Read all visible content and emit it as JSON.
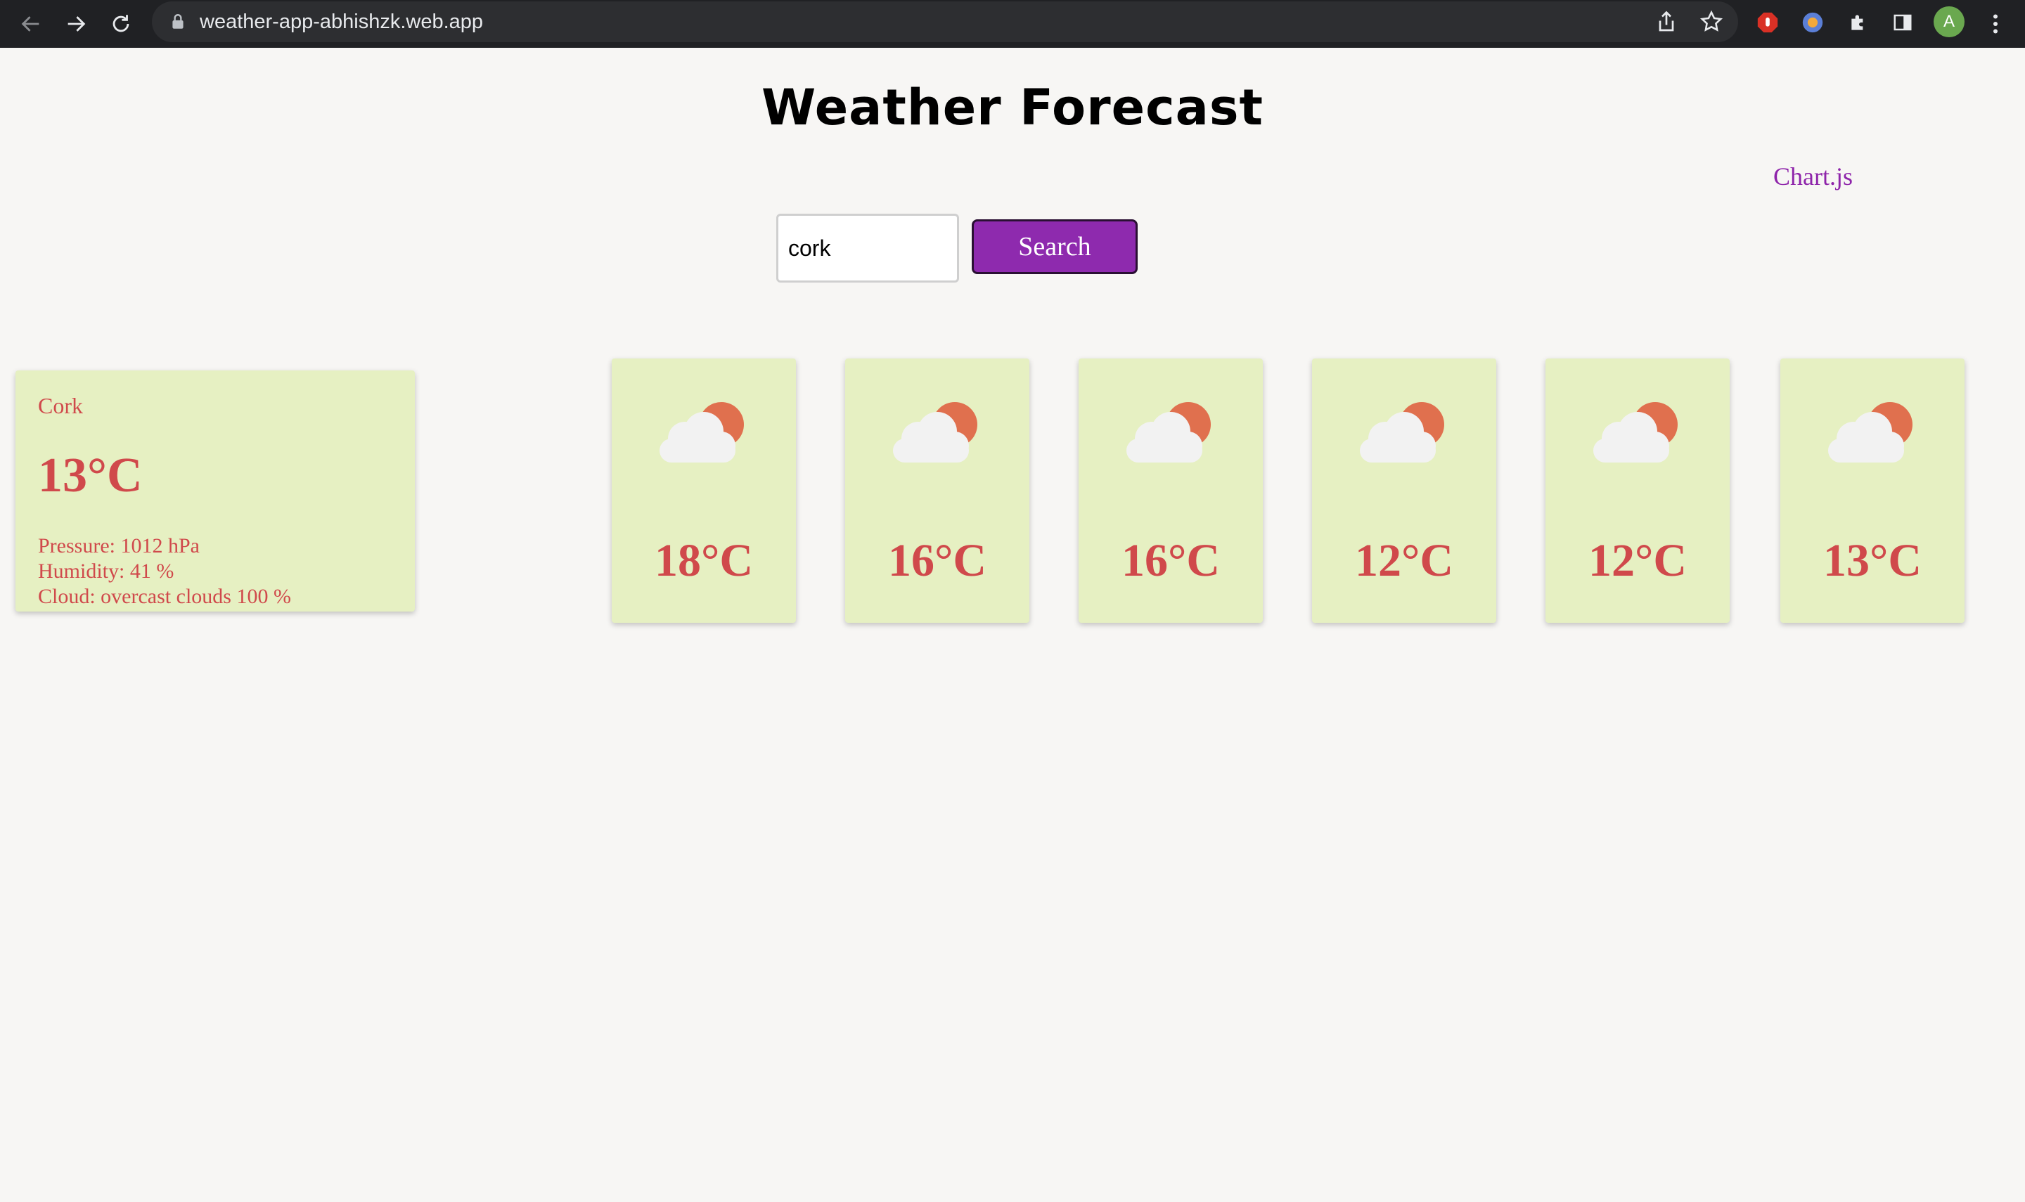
{
  "browser": {
    "url": "weather-app-abhishzk.web.app",
    "profile_initial": "A",
    "icons": [
      "back-icon",
      "forward-icon",
      "reload-icon",
      "lock-icon",
      "share-icon",
      "star-icon",
      "extension-icons",
      "puzzle-icon",
      "side-panel-icon",
      "menu-icon"
    ]
  },
  "page": {
    "title": "Weather Forecast",
    "chart_link": "Chart.js"
  },
  "search": {
    "value": "cork",
    "button_label": "Search"
  },
  "current": {
    "city": "Cork",
    "temp": "13°C",
    "pressure": "Pressure: 1012 hPa",
    "humidity": "Humidity: 41 %",
    "cloud": "Cloud: overcast clouds 100 %"
  },
  "forecast": [
    {
      "temp": "18°C",
      "icon": "partly-cloudy-icon"
    },
    {
      "temp": "16°C",
      "icon": "partly-cloudy-icon"
    },
    {
      "temp": "16°C",
      "icon": "partly-cloudy-icon"
    },
    {
      "temp": "12°C",
      "icon": "partly-cloudy-icon"
    },
    {
      "temp": "12°C",
      "icon": "partly-cloudy-icon"
    },
    {
      "temp": "13°C",
      "icon": "partly-cloudy-icon"
    }
  ],
  "colors": {
    "accent": "#8e2aae",
    "card": "#e6f0c2",
    "temp_text": "#d0494b",
    "sun": "#e0704e",
    "cloud": "#f2f2f2"
  }
}
